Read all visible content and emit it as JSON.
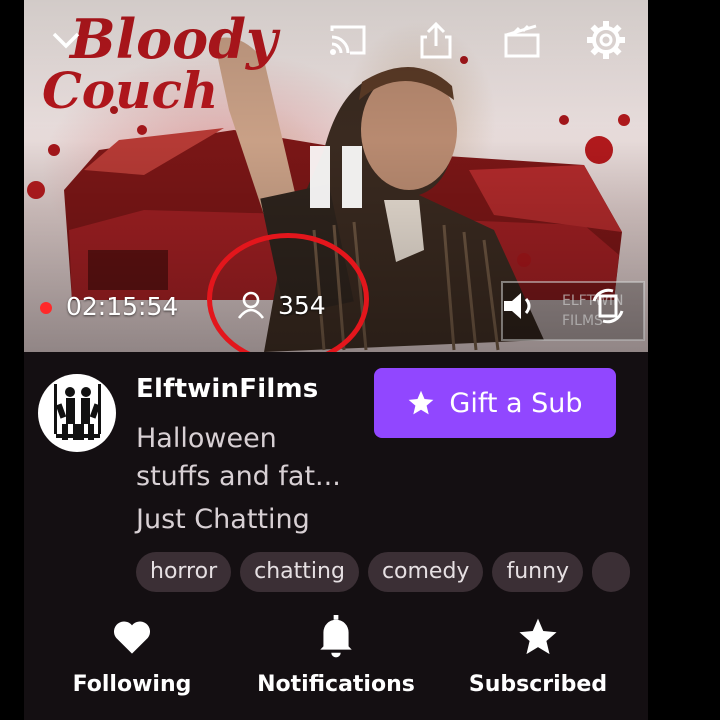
{
  "player": {
    "title_art_text": "Bloody Couch",
    "duration": "02:15:54",
    "viewer_count": "354",
    "watermark": "ELFTWIN FILMS",
    "icons": [
      "chevron-down-icon",
      "cast-icon",
      "share-icon",
      "clip-icon",
      "settings-icon",
      "pause-icon",
      "volume-icon",
      "rotate-icon",
      "person-icon"
    ],
    "live_color": "#ff2a2a",
    "annotation_color": "#e3161c"
  },
  "channel": {
    "name": "ElftwinFilms",
    "title_line1": "Halloween",
    "title_line2": "stuffs and fat...",
    "category": "Just Chatting",
    "tags": [
      "horror",
      "chatting",
      "comedy",
      "funny"
    ]
  },
  "gift": {
    "label": "Gift a Sub",
    "color": "#9147ff",
    "icon": "star-icon"
  },
  "actions": {
    "following": {
      "label": "Following",
      "icon": "heart-icon"
    },
    "notifications": {
      "label": "Notifications",
      "icon": "bell-icon"
    },
    "subscribed": {
      "label": "Subscribed",
      "icon": "star-icon"
    }
  }
}
